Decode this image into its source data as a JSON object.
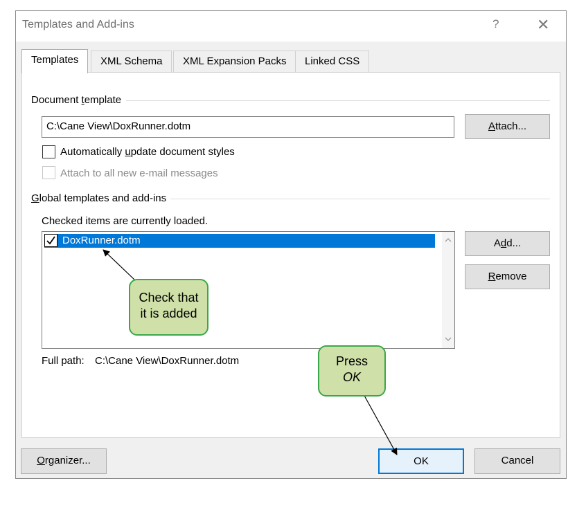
{
  "window": {
    "title": "Templates and Add-ins",
    "help_label": "?",
    "close_label": "✕"
  },
  "tabs": [
    {
      "label": "Templates",
      "active": true
    },
    {
      "label": "XML Schema",
      "active": false
    },
    {
      "label": "XML Expansion Packs",
      "active": false
    },
    {
      "label": "Linked CSS",
      "active": false
    }
  ],
  "document_template": {
    "group_label_pre": "Document ",
    "group_label_u": "t",
    "group_label_post": "emplate",
    "path_value": "C:\\Cane View\\DoxRunner.dotm",
    "attach_pre": "",
    "attach_u": "A",
    "attach_post": "ttach...",
    "auto_update_pre": "Automatically ",
    "auto_update_u": "u",
    "auto_update_post": "pdate document styles",
    "auto_update_checked": false,
    "attach_email_label": "Attach to all new e-mail messages",
    "attach_email_checked": false
  },
  "global_templates": {
    "group_label_u": "G",
    "group_label_post": "lobal templates and add-ins",
    "hint": "Checked items are currently loaded.",
    "items": [
      {
        "label": "DoxRunner.dotm",
        "checked": true,
        "selected": true
      }
    ],
    "add_pre": "A",
    "add_u": "d",
    "add_post": "d...",
    "remove_u": "R",
    "remove_post": "emove",
    "full_path_label": "Full path:",
    "full_path_value": "C:\\Cane View\\DoxRunner.dotm"
  },
  "footer": {
    "organizer_u": "O",
    "organizer_post": "rganizer...",
    "ok_label": "OK",
    "cancel_label": "Cancel"
  },
  "annotations": {
    "callout_added_line1": "Check that",
    "callout_added_line2": "it is added",
    "callout_ok_line1": "Press",
    "callout_ok_line2": "OK",
    "callout_color": "#cfe0a8",
    "callout_border": "#3aa84a"
  },
  "colors": {
    "accent": "#0078d7",
    "dialog_bg": "#f0f0f0"
  }
}
